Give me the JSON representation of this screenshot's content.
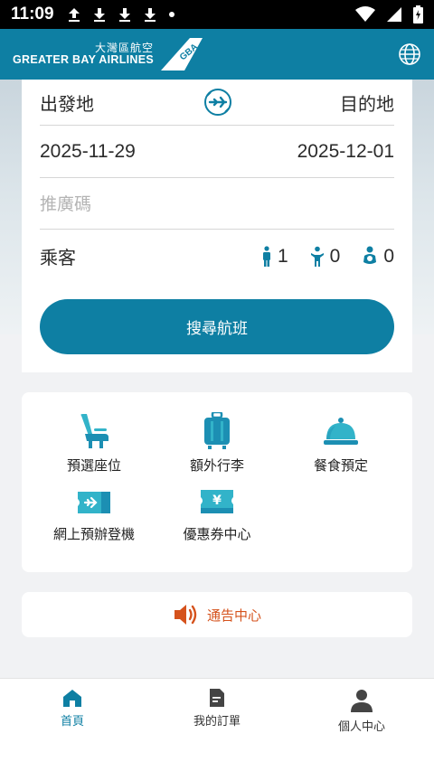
{
  "status_bar": {
    "time": "11:09",
    "left_icons": [
      "upload-icon",
      "download-icon",
      "download-icon",
      "download-icon",
      "dot-icon"
    ],
    "right_icons": [
      "wifi-icon",
      "signal-icon",
      "battery-icon"
    ]
  },
  "header": {
    "logo_cn": "大灣區航空",
    "logo_en": "GREATER BAY AIRLINES",
    "logo_badge": "GBA",
    "globe_icon": "globe-icon",
    "brand_color": "#0e7fa3"
  },
  "search": {
    "origin_label": "出發地",
    "destination_label": "目的地",
    "depart_date": "2025-11-29",
    "return_date": "2025-12-01",
    "promo_placeholder": "推廣碼",
    "passenger_label": "乘客",
    "adults": "1",
    "children": "0",
    "infants": "0",
    "search_button": "搜尋航班"
  },
  "services": [
    {
      "label": "預選座位",
      "icon": "seat-icon"
    },
    {
      "label": "額外行李",
      "icon": "luggage-icon"
    },
    {
      "label": "餐食預定",
      "icon": "meal-cloche-icon"
    },
    {
      "label": "網上預辦登機",
      "icon": "boarding-ticket-icon"
    },
    {
      "label": "優惠券中心",
      "icon": "coupon-icon"
    }
  ],
  "notice": {
    "label": "通告中心",
    "icon": "speaker-icon",
    "color": "#d5521c"
  },
  "bottom_nav": [
    {
      "label": "首頁",
      "icon": "home-icon",
      "active": true
    },
    {
      "label": "我的訂單",
      "icon": "document-icon",
      "active": false
    },
    {
      "label": "個人中心",
      "icon": "person-icon",
      "active": false
    }
  ]
}
